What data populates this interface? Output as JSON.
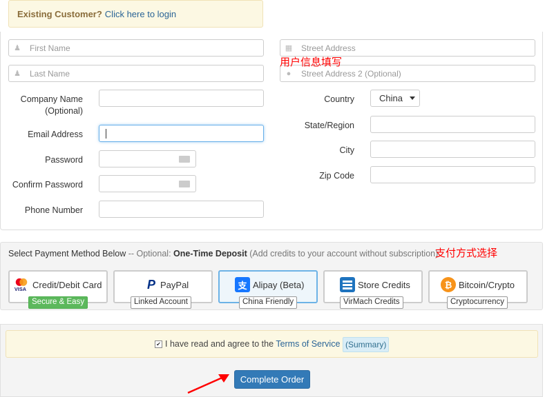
{
  "notice": {
    "strong": "Existing Customer?",
    "link": "Click here to login"
  },
  "fields": {
    "first_name_placeholder": "First Name",
    "last_name_placeholder": "Last Name",
    "street_placeholder": "Street Address",
    "street2_placeholder": "Street Address 2 (Optional)",
    "company_label": "Company Name (Optional)",
    "email_label": "Email Address",
    "password_label": "Password",
    "confirm_password_label": "Confirm Password",
    "phone_label": "Phone Number",
    "country_label": "Country",
    "country_value": "China",
    "state_label": "State/Region",
    "city_label": "City",
    "zip_label": "Zip Code"
  },
  "annotations": {
    "user_info": "用户信息填写",
    "payment": "支付方式选择"
  },
  "payment": {
    "intro_text": "Select Payment Method Below",
    "intro_dash": " -- Optional: ",
    "intro_bold": "One-Time Deposit",
    "intro_tail": " (Add credits to your account without subscription)",
    "methods": [
      {
        "label": "Credit/Debit Card",
        "badge": "Secure & Easy",
        "icon": "credit-card-icon"
      },
      {
        "label": "PayPal",
        "badge": "Linked Account",
        "icon": "paypal-icon"
      },
      {
        "label": "Alipay (Beta)",
        "badge": "China Friendly",
        "icon": "alipay-icon"
      },
      {
        "label": "Store Credits",
        "badge": "VirMach Credits",
        "icon": "store-credits-icon"
      },
      {
        "label": "Bitcoin/Crypto",
        "badge": "Cryptocurrency",
        "icon": "bitcoin-icon"
      }
    ],
    "selected_index": 2
  },
  "tos": {
    "text": "I have read and agree to the ",
    "link": "Terms of Service",
    "summary": "(Summary)",
    "checked": true
  },
  "submit": {
    "label": "Complete Order"
  },
  "colors": {
    "primary": "#337ab7",
    "annotation": "#ff0000",
    "badge_green": "#5cb85c"
  }
}
